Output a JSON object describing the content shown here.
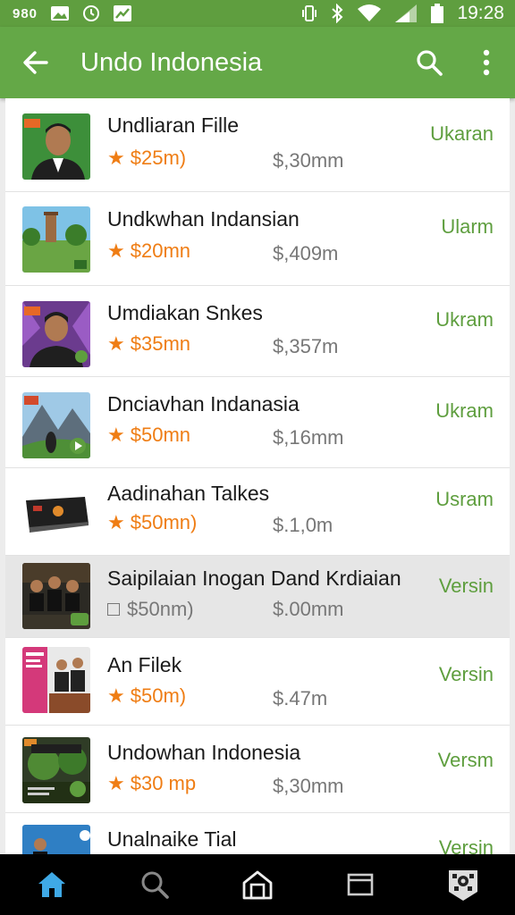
{
  "status_bar": {
    "left_text": "980",
    "time": "19:28",
    "icons": [
      "image-icon",
      "clock-icon",
      "chart-icon",
      "vibrate-icon",
      "bluetooth-icon",
      "wifi-icon",
      "signal-icon",
      "battery-icon"
    ]
  },
  "app_bar": {
    "title": "Undo Indonesia",
    "icons": [
      "back-arrow-icon",
      "search-icon",
      "more-vert-icon"
    ]
  },
  "colors": {
    "status_bar": "#5f9e3f",
    "app_bar": "#64a847",
    "price": "#ef7d14",
    "action": "#5e9e3e",
    "nav_active": "#3fa9e6"
  },
  "items": [
    {
      "title": "Undliaran Fille",
      "price": "$25m)",
      "price_icon": "star-icon",
      "size": "$,30mm",
      "action": "Ukaran"
    },
    {
      "title": "Undkwhan  Indansian",
      "price": "$20mn",
      "price_icon": "star-icon",
      "size": "$,409m",
      "action": "Ularm"
    },
    {
      "title": "Umdiakan Snkes",
      "price": "$35mn",
      "price_icon": "star-icon",
      "size": "$,357m",
      "action": "Ukram"
    },
    {
      "title": "Dnciavhan Indanasia",
      "price": "$50mn",
      "price_icon": "star-icon",
      "size": "$,16mm",
      "action": "Ukram"
    },
    {
      "title": "Aadinahan Talkes",
      "price": "$50mn)",
      "price_icon": "star-icon",
      "size": "$.1,0m",
      "action": "Usram"
    },
    {
      "title": "Saipilaian Inogan Dand Krdiaian",
      "price": "$50nm)",
      "price_icon": "checkbox-icon",
      "size": "$.00mm",
      "action": "Versin"
    },
    {
      "title": "An Filek",
      "price": "$50m)",
      "price_icon": "star-icon",
      "size": "$.47m",
      "action": "Versin"
    },
    {
      "title": "Undowhan Indonesia",
      "price": "$30 mp",
      "price_icon": "star-icon",
      "size": "$,30mm",
      "action": "Versm"
    },
    {
      "title": "Unalnaike Tial",
      "price": "",
      "price_icon": "",
      "size": "",
      "action": "Versin"
    }
  ],
  "nav": {
    "items": [
      "home-icon",
      "search-icon",
      "store-icon",
      "window-icon",
      "profile-badge-icon"
    ],
    "active": "home-icon"
  }
}
